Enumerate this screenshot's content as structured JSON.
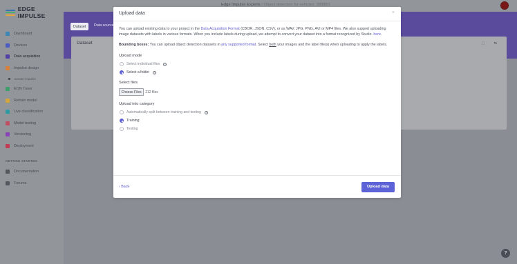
{
  "app": {
    "logo_text": "EDGE IMPULSE",
    "project_title": "Edge Impulse Experts",
    "project_subtitle": "/ Object detection for vehicles: 389880",
    "colors": {
      "accent": "#5d62d6",
      "banner": "#5a4b9c",
      "logo_bars": [
        "#3d6fb5",
        "#47b070",
        "#e6a73a"
      ]
    }
  },
  "sidebar": {
    "items": [
      {
        "label": "Dashboard",
        "icon": "monitor-icon",
        "color": "#3e86b5"
      },
      {
        "label": "Devices",
        "icon": "device-icon",
        "color": "#4a5cc0"
      },
      {
        "label": "Data acquisition",
        "icon": "database-icon",
        "color": "#5340a6",
        "active": true
      },
      {
        "label": "Impulse design",
        "icon": "impulse-icon",
        "color": "#d6803a"
      },
      {
        "label": "Create impulse",
        "icon": "dot-icon",
        "sub": true
      },
      {
        "label": "EON Tuner",
        "icon": "tuner-icon",
        "color": "#3f9f6b"
      },
      {
        "label": "Retrain model",
        "icon": "retrain-icon",
        "color": "#d3a53d"
      },
      {
        "label": "Live classification",
        "icon": "live-icon",
        "color": "#2e9aa3"
      },
      {
        "label": "Model testing",
        "icon": "testing-icon",
        "color": "#c04f64"
      },
      {
        "label": "Versioning",
        "icon": "versioning-icon",
        "color": "#8a45b5"
      },
      {
        "label": "Deployment",
        "icon": "deploy-icon",
        "color": "#c03c55"
      }
    ],
    "section_label": "GETTING STARTED",
    "section_items": [
      {
        "label": "Documentation",
        "icon": "docs-icon",
        "color": "#55595f"
      },
      {
        "label": "Forums",
        "icon": "forums-icon",
        "color": "#55595f"
      }
    ]
  },
  "main": {
    "tab_dataset": "Dataset",
    "tab_source": "Data sources",
    "card_title": "Dataset",
    "card_icons": "⬚ ⇆"
  },
  "modal": {
    "title": "Upload data",
    "close": "×",
    "intro_1": "You can upload existing data to your project in the ",
    "intro_link_1": "Data Acquisition Format",
    "intro_2": " (CBOR, JSON, CSV), or as WAV, JPG, PNG, AVI or MP4 files. We also support uploading image datasets with labels in various formats. When you include labels during upload, we attempt to convert your dataset into a format recognized by Studio. ",
    "intro_link_2": "here",
    "intro_3": ".",
    "bb_bold": "Bounding boxes:",
    "bb_1": " You can upload object detection datasets in ",
    "bb_link": "any supported format",
    "bb_2": ". Select ",
    "bb_underline": "both",
    "bb_3": " your images and the label file(s) when uploading to apply the labels.",
    "upload_mode_label": "Upload mode",
    "mode_individual": "Select individual files",
    "mode_folder": "Select a folder",
    "mode_selected": "folder",
    "select_files_label": "Select files",
    "choose_files": "Choose Files",
    "files_count": "212 files",
    "category_label": "Upload into category",
    "cat_auto": "Automatically split between training and testing",
    "cat_training": "Training",
    "cat_testing": "Testing",
    "category_selected": "training",
    "back": "‹ Back",
    "upload_button": "Upload data"
  },
  "help_icon": "?"
}
